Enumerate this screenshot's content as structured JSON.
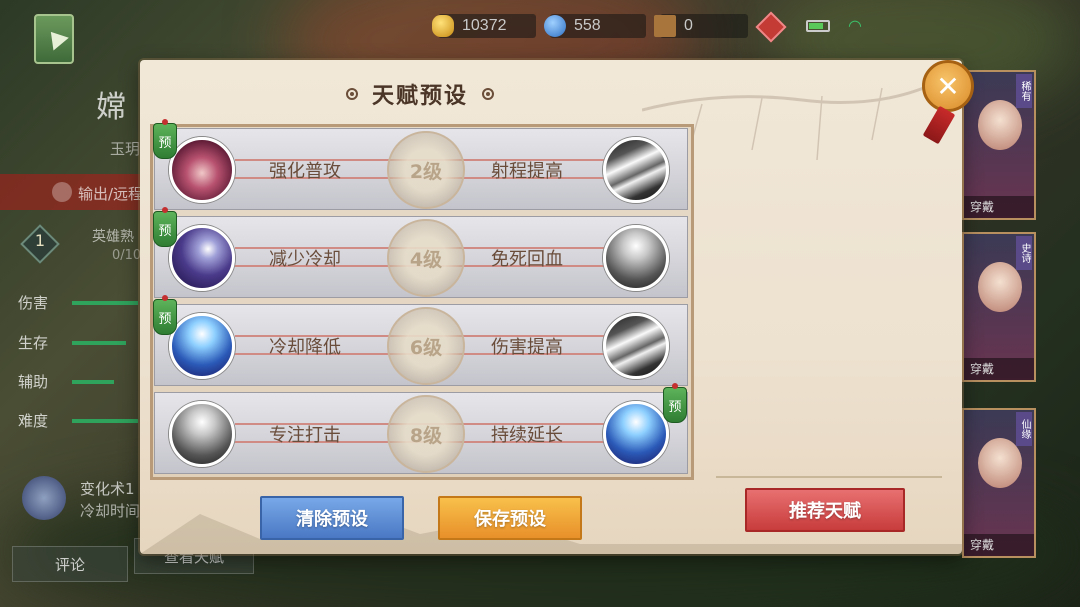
{
  "resources": {
    "gold": "10372",
    "gem": "558",
    "tower": "0"
  },
  "left_panel": {
    "hero_name": "嫦",
    "hero_sub": "玉玥",
    "role": "输出/远程",
    "level": "1",
    "proficiency_label": "英雄熟",
    "proficiency_value": "0/10",
    "stats": [
      {
        "label": "伤害",
        "fill": 0.55
      },
      {
        "label": "生存",
        "fill": 0.45
      },
      {
        "label": "辅助",
        "fill": 0.35
      },
      {
        "label": "难度",
        "fill": 0.55
      }
    ],
    "skill_name": "变化术1",
    "skill_cd": "冷却时间",
    "comment_btn": "评论",
    "view_talent_btn": "查看天赋"
  },
  "skins": [
    {
      "tag": "稀有",
      "wear": "穿戴"
    },
    {
      "tag": "史诗",
      "wear": "穿戴"
    },
    {
      "tag": "仙缘",
      "wear": "穿戴"
    }
  ],
  "popup": {
    "title": "天赋预设",
    "close_symbol": "✕",
    "preset_badge": "预",
    "rows": [
      {
        "left": "强化普攻",
        "level": "2级",
        "right": "射程提高",
        "badge_side": "left"
      },
      {
        "left": "减少冷却",
        "level": "4级",
        "right": "免死回血",
        "badge_side": "left"
      },
      {
        "left": "冷却降低",
        "level": "6级",
        "right": "伤害提高",
        "badge_side": "left"
      },
      {
        "left": "专注打击",
        "level": "8级",
        "right": "持续延长",
        "badge_side": "right"
      }
    ],
    "clear_btn": "清除预设",
    "save_btn": "保存预设",
    "recommend_btn": "推荐天赋"
  }
}
